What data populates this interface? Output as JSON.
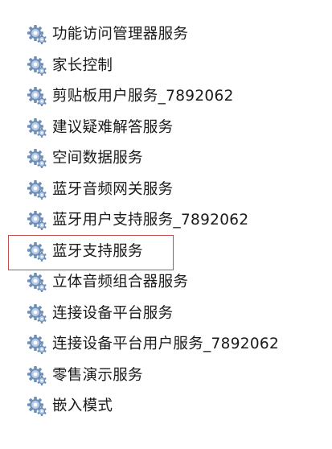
{
  "services": [
    {
      "label": "功能访问管理器服务",
      "icon": "gear-icon"
    },
    {
      "label": "家长控制",
      "icon": "gear-icon"
    },
    {
      "label": "剪贴板用户服务_7892062",
      "icon": "gear-icon"
    },
    {
      "label": "建议疑难解答服务",
      "icon": "gear-icon"
    },
    {
      "label": "空间数据服务",
      "icon": "gear-icon"
    },
    {
      "label": "蓝牙音频网关服务",
      "icon": "gear-icon"
    },
    {
      "label": "蓝牙用户支持服务_7892062",
      "icon": "gear-icon"
    },
    {
      "label": "蓝牙支持服务",
      "icon": "gear-icon",
      "highlighted": true
    },
    {
      "label": "立体音频组合器服务",
      "icon": "gear-icon"
    },
    {
      "label": "连接设备平台服务",
      "icon": "gear-icon"
    },
    {
      "label": "连接设备平台用户服务_7892062",
      "icon": "gear-icon"
    },
    {
      "label": "零售演示服务",
      "icon": "gear-icon"
    },
    {
      "label": "嵌入模式",
      "icon": "gear-icon"
    }
  ],
  "colors": {
    "highlight_border": "#c0504d",
    "gear_outer": "#6f8fb8",
    "gear_inner": "#b9cde6"
  }
}
